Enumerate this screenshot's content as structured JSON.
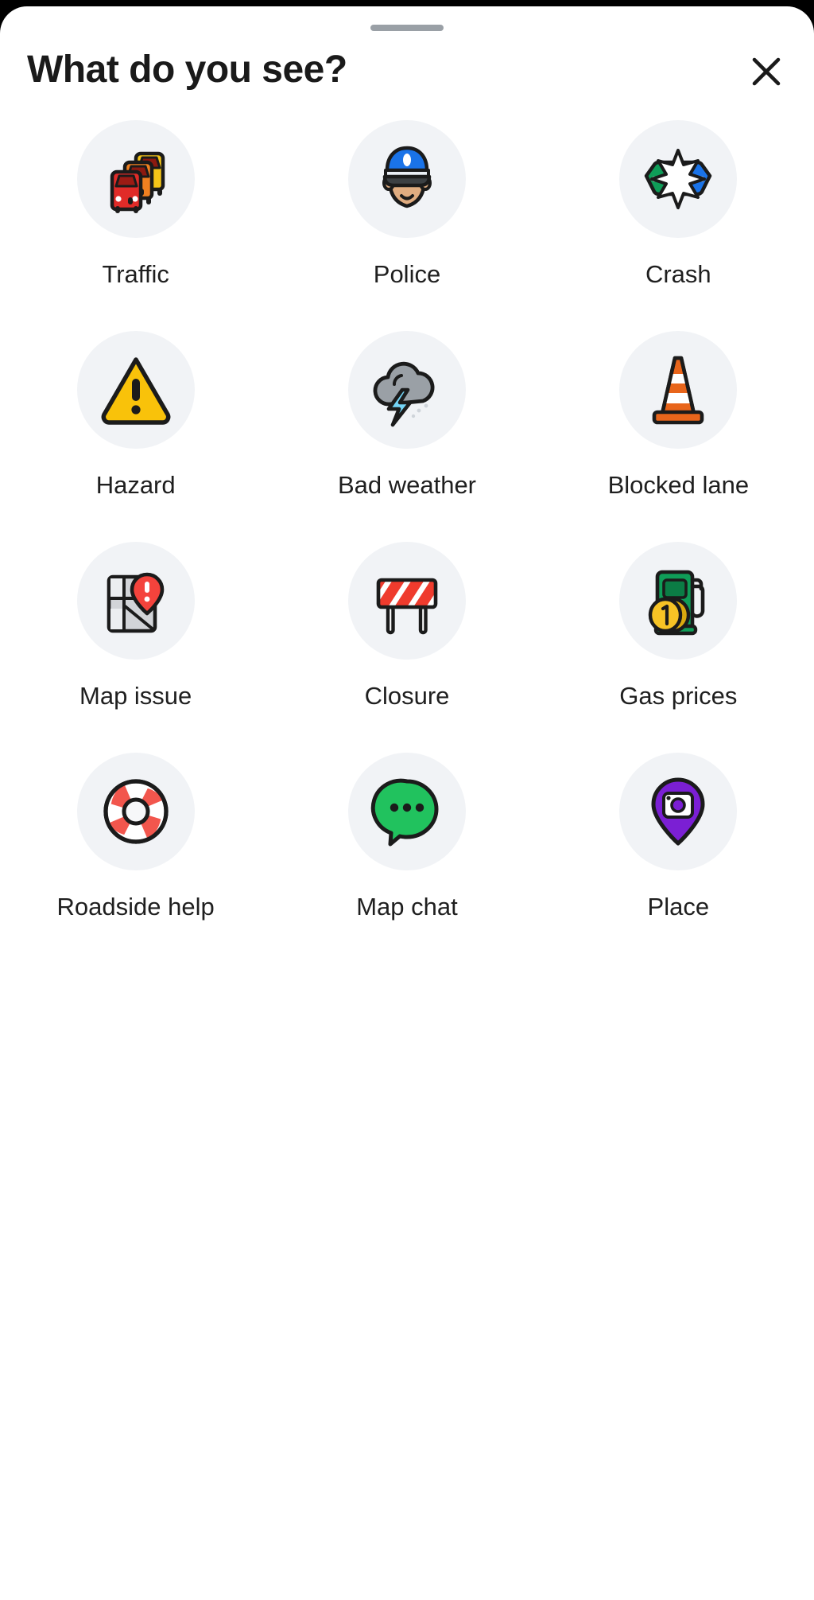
{
  "sheet": {
    "title": "What do you see?",
    "drag_handle": "drag-handle",
    "close_label": "✕"
  },
  "colors": {
    "sheet_background": "#ffffff",
    "page_background": "#000000",
    "icon_bubble": "#f1f3f6",
    "title_text": "#1a1a1a",
    "label_text": "#1f1f1f",
    "handle": "#9aa0a6",
    "traffic_car_front": "#e02b28",
    "traffic_car_mid": "#f08020",
    "traffic_car_back": "#f5c518",
    "police_cap": "#1a73e8",
    "police_skin": "#e0ac80",
    "crash_green": "#0f9d58",
    "crash_blue": "#1a73e8",
    "crash_burst": "#ffffff",
    "hazard_yellow": "#f9c20a",
    "weather_cloud": "#9aa0a6",
    "weather_bolt": "#74d4f5",
    "cone_orange": "#e8651b",
    "map_grey": "#d2d4d8",
    "map_pin_red": "#f4433c",
    "closure_red": "#ef3b2d",
    "gas_green": "#0f9d58",
    "coin_gold": "#f7c325",
    "life_ring_red": "#f2564d",
    "chat_green": "#21c25e",
    "place_purple": "#7b1fd4",
    "outline": "#1b1b1b"
  },
  "grid": {
    "columns": 3,
    "items": [
      {
        "id": "traffic",
        "label": "Traffic",
        "icon": "traffic-jam-icon"
      },
      {
        "id": "police",
        "label": "Police",
        "icon": "police-officer-icon"
      },
      {
        "id": "crash",
        "label": "Crash",
        "icon": "car-crash-icon"
      },
      {
        "id": "hazard",
        "label": "Hazard",
        "icon": "warning-triangle-icon"
      },
      {
        "id": "bad-weather",
        "label": "Bad weather",
        "icon": "storm-cloud-icon"
      },
      {
        "id": "blocked-lane",
        "label": "Blocked lane",
        "icon": "traffic-cone-icon"
      },
      {
        "id": "map-issue",
        "label": "Map issue",
        "icon": "map-pin-alert-icon"
      },
      {
        "id": "closure",
        "label": "Closure",
        "icon": "road-barricade-icon"
      },
      {
        "id": "gas-prices",
        "label": "Gas prices",
        "icon": "fuel-pump-coin-icon"
      },
      {
        "id": "roadside-help",
        "label": "Roadside help",
        "icon": "life-ring-icon"
      },
      {
        "id": "map-chat",
        "label": "Map chat",
        "icon": "speech-bubble-icon"
      },
      {
        "id": "place",
        "label": "Place",
        "icon": "place-pin-camera-icon"
      }
    ]
  }
}
